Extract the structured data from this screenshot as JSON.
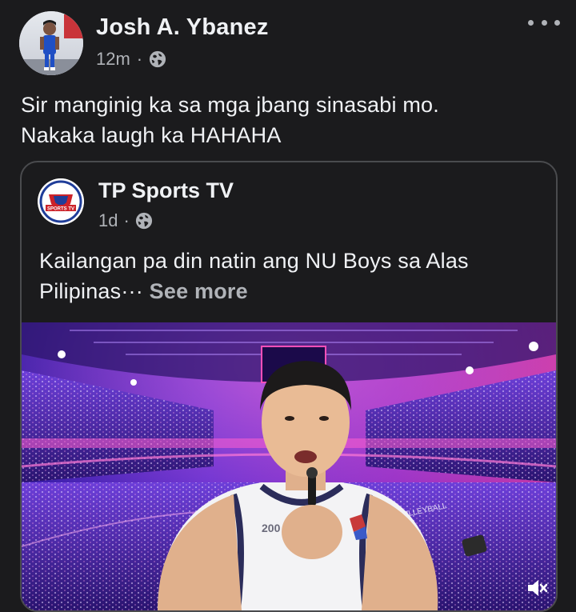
{
  "post": {
    "author": "Josh A. Ybanez",
    "time": "12m",
    "separator": "·",
    "privacy_icon": "globe-icon",
    "more_icon": "more-dots-icon",
    "text_line1": "Sir manginig ka sa mga jbang sinasabi mo.",
    "text_line2": "Nakaka laugh ka HAHAHA"
  },
  "shared": {
    "page_name": "TP Sports TV",
    "time": "1d",
    "separator": "·",
    "privacy_icon": "globe-icon",
    "text_line1": "Kailangan pa din natin ang NU Boys sa Alas",
    "text_line2": "Pilipinas",
    "ellipsis": "···",
    "see_more": "See more",
    "logo_text": "SPORTS TV",
    "video_icon": "mute-icon",
    "jersey_text": "200",
    "banner_text": "VOLLEYBALL"
  },
  "colors": {
    "background": "#1b1b1d",
    "text_primary": "#f0f2f5",
    "text_secondary": "#b0b3b8",
    "card_border": "#4a4b4e"
  }
}
